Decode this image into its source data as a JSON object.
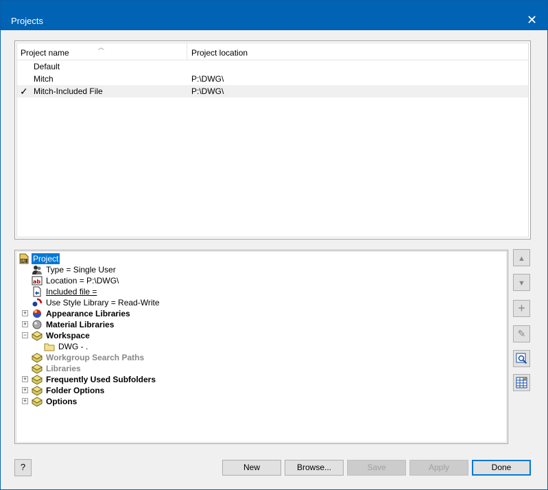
{
  "window": {
    "title": "Projects",
    "close_glyph": "✕"
  },
  "list": {
    "columns": [
      "Project name",
      "Project location"
    ],
    "rows": [
      {
        "name": "Default",
        "location": "",
        "active": false
      },
      {
        "name": "Mitch",
        "location": "P:\\DWG\\",
        "active": false
      },
      {
        "name": "Mitch-Included File",
        "location": "P:\\DWG\\",
        "active": true
      }
    ],
    "active_mark": "✓"
  },
  "tree": {
    "root": "Project",
    "type": "Type = Single User",
    "location": "Location = P:\\DWG\\",
    "included": "Included file =",
    "style": "Use Style Library = Read-Write",
    "appearance": "Appearance Libraries",
    "material": "Material Libraries",
    "workspace": "Workspace",
    "dwg": "DWG - .",
    "workgroup": "Workgroup Search Paths",
    "libraries": "Libraries",
    "frequent": "Frequently Used Subfolders",
    "folder_options": "Folder Options",
    "options": "Options",
    "expand_plus": "+",
    "expand_minus": "−"
  },
  "side_buttons": {
    "up": "▲",
    "down": "▼",
    "add": "+",
    "edit": "✎",
    "find": "🔍",
    "grid": "▦"
  },
  "buttons": {
    "help": "?",
    "new": "New",
    "browse": "Browse...",
    "save": "Save",
    "apply": "Apply",
    "done": "Done"
  },
  "colors": {
    "titlebar": "#0163b4",
    "selection": "#0078d7"
  }
}
